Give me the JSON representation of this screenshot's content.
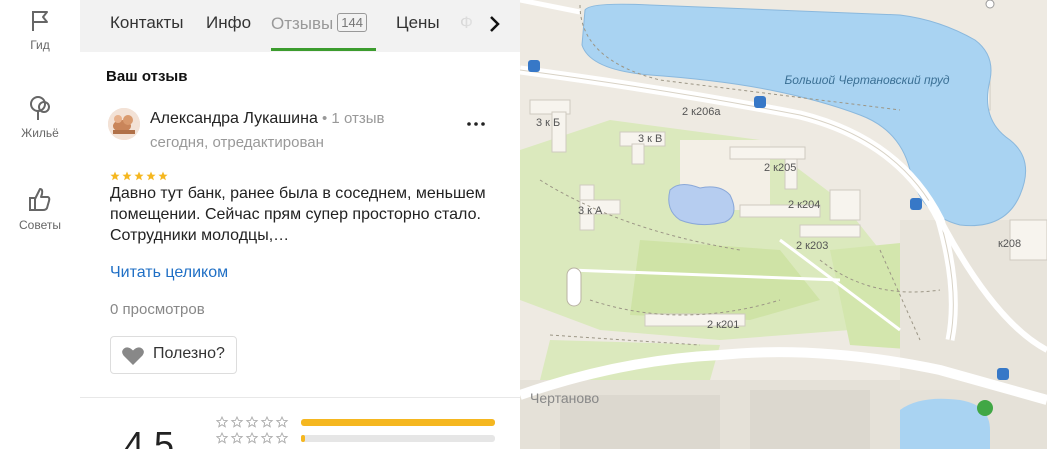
{
  "rail": {
    "guide": "Гид",
    "housing": "Жильё",
    "tips": "Советы"
  },
  "tabs": {
    "contacts": "Контакты",
    "info": "Инфо",
    "reviews": "Отзывы",
    "reviews_count": "144",
    "prices": "Цены",
    "photos": "Ф"
  },
  "review": {
    "section_title": "Ваш отзыв",
    "author": "Александра Лукашина",
    "author_meta": " • 1 отзыв",
    "date": "сегодня, отредактирован",
    "rating": 5,
    "text": "Давно тут банк, ранее была в соседнем, меньшем помещении. Сейчас прям супер просторно стало. Сотрудники молодцы,…",
    "read_more": "Читать целиком",
    "views": "0 просмотров",
    "helpful": "Полезно?"
  },
  "summary": {
    "rating": "4,5",
    "distribution": [
      {
        "stars": 5,
        "fraction": 1.0
      },
      {
        "stars": 4,
        "fraction": 0.02
      }
    ]
  },
  "map": {
    "labels": {
      "pond": "Большой Чертановский пруд",
      "b1": "3 к Б",
      "b2": "3 к В",
      "b3": "3 к А",
      "b4": "2 к206а",
      "b5": "2 к205",
      "b6": "2 к204",
      "b7": "2 к203",
      "b8": "2 к201",
      "b9": "к208",
      "district": "Чертаново"
    },
    "colors": {
      "water": "#a9d3f2",
      "park": "#d7e8b4",
      "road": "#ffffff",
      "block": "#f3efe6"
    }
  },
  "colors": {
    "accent_green": "#3c9c2e",
    "link_blue": "#1f6fc5",
    "star_gold": "#f5b720"
  }
}
